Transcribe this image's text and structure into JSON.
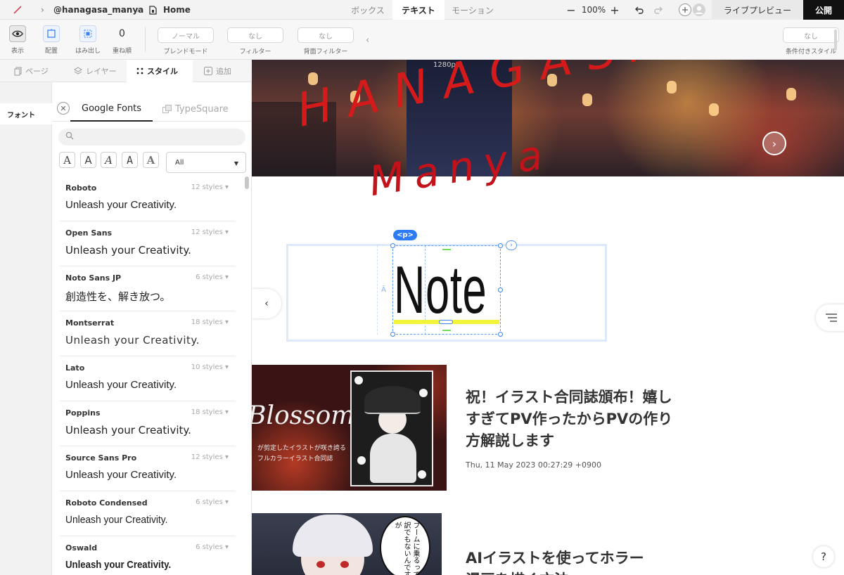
{
  "topbar": {
    "user": "@hanagasa_manya",
    "page": "Home",
    "tabs": [
      "ボックス",
      "テキスト",
      "モーション"
    ],
    "active_tab": "テキスト",
    "zoom": "100%",
    "live_preview": "ライブプレビュー",
    "publish": "公開"
  },
  "toolbar": {
    "view_label": "表示",
    "placement_label": "配置",
    "overflow_label": "はみ出し",
    "zindex_value": "0",
    "zindex_label": "重ね順",
    "blend_value": "ノーマル",
    "blend_label": "ブレンドモード",
    "filter_value": "なし",
    "filter_label": "フィルター",
    "backdrop_value": "なし",
    "backdrop_label": "背面フィルター",
    "conditional_value": "なし",
    "conditional_label": "条件付きスタイル"
  },
  "panel_tabs": {
    "pages": "ページ",
    "layers": "レイヤー",
    "style": "スタイル",
    "add": "追加"
  },
  "left_col": {
    "font_category": "フォント"
  },
  "font_panel": {
    "tab_google": "Google Fonts",
    "tab_typesquare": "TypeSquare",
    "search_placeholder": "",
    "style_buttons": [
      "A",
      "A",
      "A",
      "A",
      "A"
    ],
    "category": "All",
    "fonts": [
      {
        "name": "Roboto",
        "styles": "12 styles",
        "sample": "Unleash your Creativity."
      },
      {
        "name": "Open Sans",
        "styles": "12 styles",
        "sample": "Unleash your Creativity."
      },
      {
        "name": "Noto Sans JP",
        "styles": "6 styles",
        "sample": "創造性を、解き放つ。"
      },
      {
        "name": "Montserrat",
        "styles": "18 styles",
        "sample": "Unleash your Creativity."
      },
      {
        "name": "Lato",
        "styles": "10 styles",
        "sample": "Unleash your Creativity."
      },
      {
        "name": "Poppins",
        "styles": "18 styles",
        "sample": "Unleash your Creativity."
      },
      {
        "name": "Source Sans Pro",
        "styles": "12 styles",
        "sample": "Unleash your Creativity."
      },
      {
        "name": "Roboto Condensed",
        "styles": "6 styles",
        "sample": "Unleash your Creativity."
      },
      {
        "name": "Oswald",
        "styles": "6 styles",
        "sample": "Unleash your Creativity."
      }
    ]
  },
  "canvas": {
    "width_label": "1280px",
    "hero_title_1": "HANAGASA",
    "hero_title_2": "Manya",
    "selected_tag": "<p>",
    "note_text": "Note",
    "article1": {
      "title": "祝！イラスト合同誌頒布！嬉しすぎてPV作ったからPVの作り方解説します",
      "date": "Thu, 11 May 2023 00:27:29 +0900",
      "image_word": "Blossom",
      "image_sub1": "が剪定したイラストが咲き誇る",
      "image_sub2": "フルカラーイラスト合同誌"
    },
    "article2": {
      "title_line1": "AIイラストを使ってホラー",
      "title_line2": "漫画を描く方法",
      "speech": "ブームに乗るって訳でもないんですが"
    },
    "help": "?"
  },
  "colors": {
    "accent": "#2d7cf6",
    "hero_text": "#d41a1a",
    "publish_bg": "#111111",
    "highlight": "#f3f33a"
  }
}
